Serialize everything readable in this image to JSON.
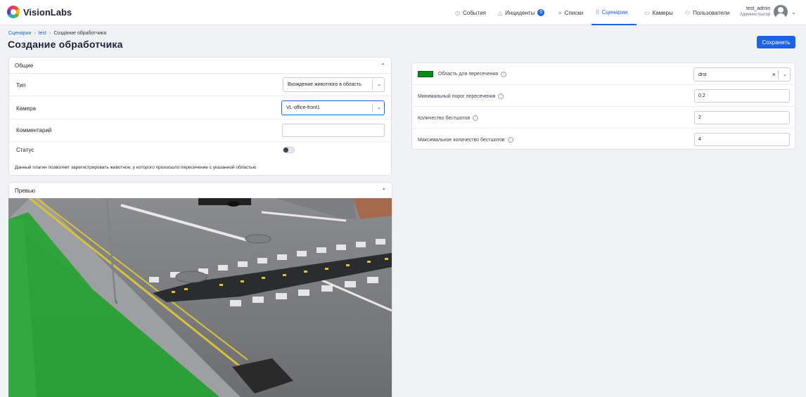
{
  "header": {
    "brand": "VisionLabs",
    "nav": [
      {
        "label": "События",
        "icon": "clock-icon"
      },
      {
        "label": "Инциденты",
        "icon": "warning-icon",
        "badge": "0"
      },
      {
        "label": "Списки",
        "icon": "list-icon"
      },
      {
        "label": "Сценарии",
        "icon": "scenario-icon",
        "active": true
      },
      {
        "label": "Камеры",
        "icon": "camera-icon"
      },
      {
        "label": "Пользователи",
        "icon": "users-icon"
      }
    ],
    "user": {
      "name": "test_admin",
      "role": "Администратор"
    }
  },
  "breadcrumb": {
    "root": "Сценарии",
    "parent": "test",
    "current": "Создание обработчика",
    "sep": "›"
  },
  "page_title": "Создание обработчика",
  "save_label": "Сохранить",
  "general": {
    "title": "Общие",
    "type_label": "Тип",
    "type_value": "Вхождение животного в область",
    "camera_label": "Камера",
    "camera_value": "VL-office-front1",
    "comment_label": "Комментарий",
    "comment_value": "",
    "status_label": "Статус",
    "status_on": false,
    "description": "Данный плагин позволяет зарегистрировать животное, у которого произошло пересечение с указанной областью"
  },
  "preview": {
    "title": "Превью"
  },
  "params": {
    "area_label": "Область для пересечения",
    "area_color": "#0a8a1a",
    "area_value": "droi",
    "min_threshold_label": "Минимальный порог пересечения",
    "min_threshold_value": "0,2",
    "bestshots_label": "Количество бестшотов",
    "bestshots_value": "2",
    "max_bestshots_label": "Максимальное количество бестшотов",
    "max_bestshots_value": "4"
  },
  "icons": {
    "chevron_up": "⌃",
    "chevron_down": "⌄",
    "clear": "×",
    "info": "i"
  },
  "colors": {
    "accent": "#1c63e8",
    "area_fill": "#27a334"
  }
}
